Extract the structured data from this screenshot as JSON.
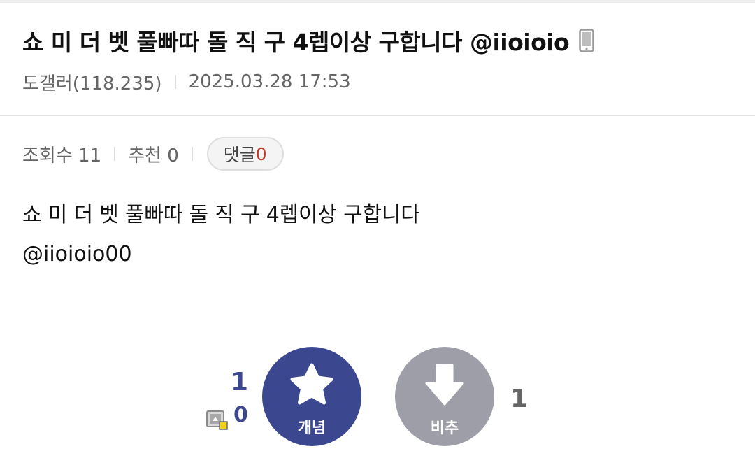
{
  "post": {
    "title": "쇼 미 더 벳 풀빠따 돌 직 구 4렙이상 구합니다 @iioioio",
    "author": "도갤러(118.235)",
    "datetime": "2025.03.28 17:53"
  },
  "stats": {
    "views_label": "조회수 11",
    "recommend_label": "추천 0",
    "comment_label": "댓글",
    "comment_count": "0"
  },
  "body": {
    "line1": "쇼 미  더  벳  풀빠따  돌 직 구 4렙이상 구합니다",
    "line2": "@iioioio00"
  },
  "votes": {
    "up_total": "1",
    "fixed_count": "0",
    "up_label": "개념",
    "down_label": "비추",
    "down_total": "1"
  },
  "colors": {
    "up_button": "#3b4890",
    "down_button": "#9e9ea8",
    "comment_count": "#c0392b"
  },
  "icons": {
    "title_device": "mobile-phone-icon",
    "up": "star-icon",
    "down": "arrow-down-icon",
    "fixed": "fixed-user-icon"
  }
}
